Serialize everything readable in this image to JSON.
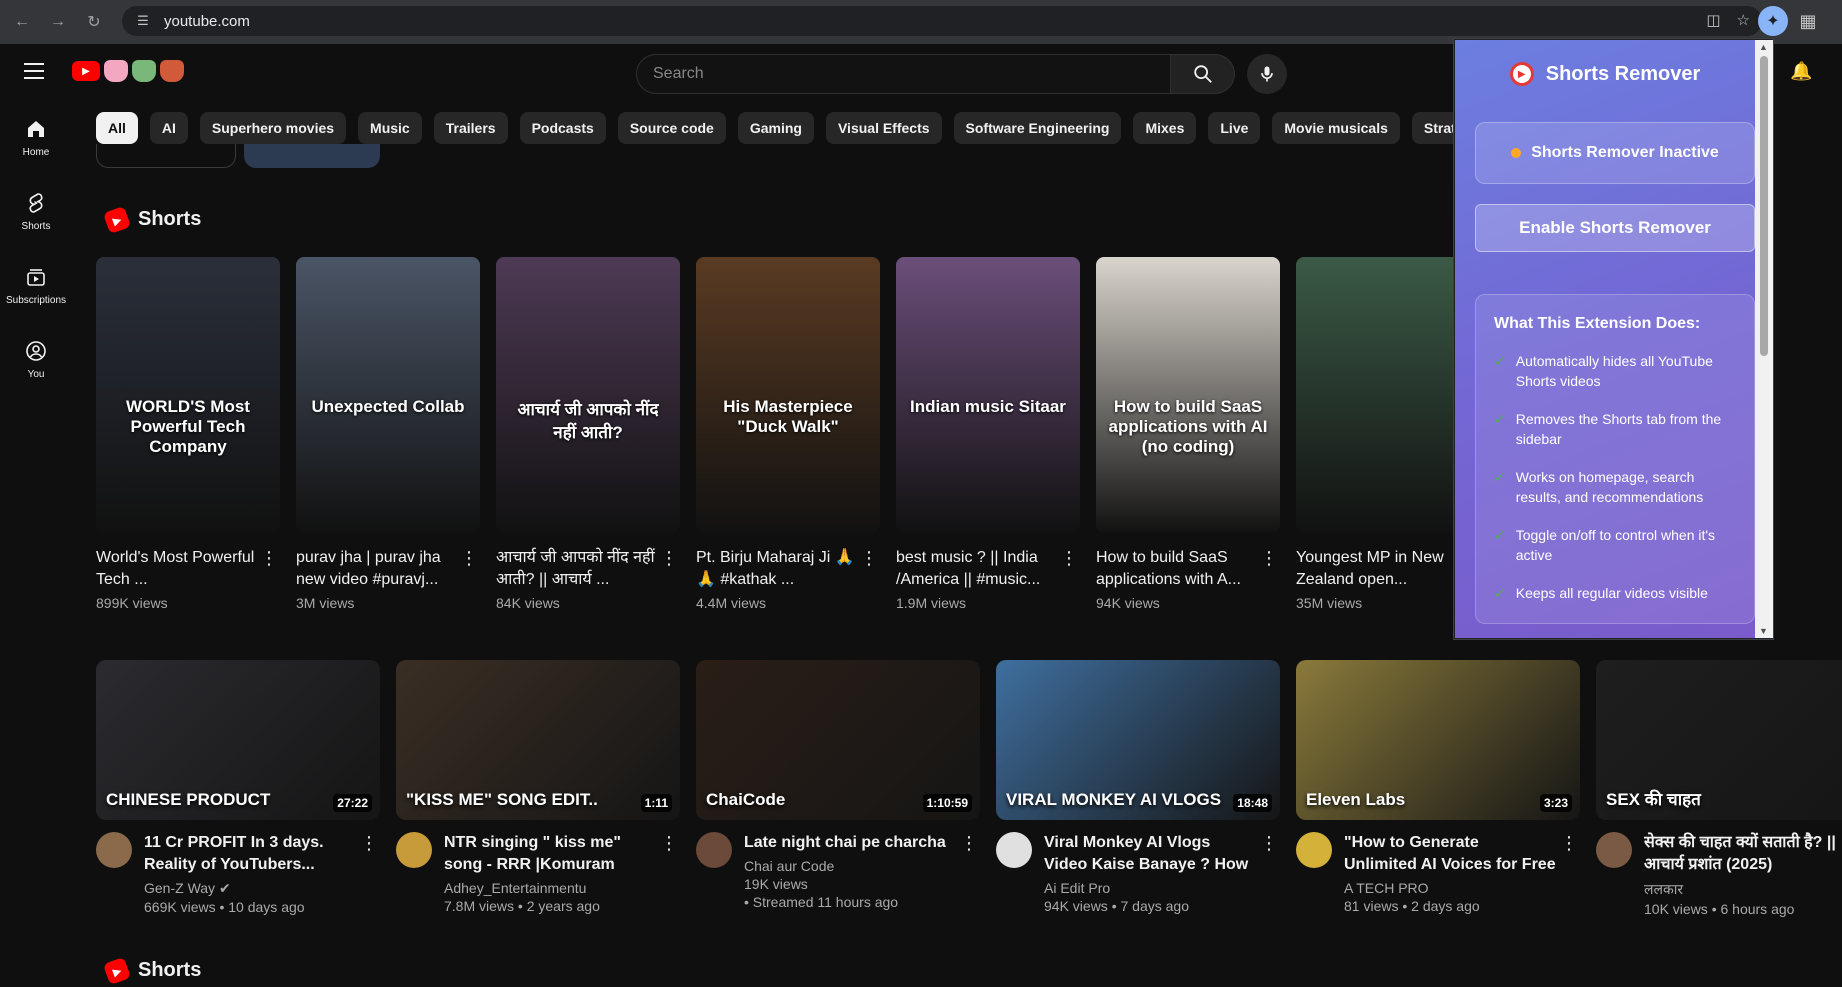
{
  "browser": {
    "url": "youtube.com"
  },
  "search": {
    "placeholder": "Search"
  },
  "guide": [
    {
      "label": "Home",
      "icon": "home-icon"
    },
    {
      "label": "Shorts",
      "icon": "shorts-icon"
    },
    {
      "label": "Subscriptions",
      "icon": "subscriptions-icon"
    },
    {
      "label": "You",
      "icon": "you-icon"
    }
  ],
  "chips": [
    "All",
    "AI",
    "Superhero movies",
    "Music",
    "Trailers",
    "Podcasts",
    "Source code",
    "Gaming",
    "Visual Effects",
    "Software Engineering",
    "Mixes",
    "Live",
    "Movie musicals",
    "Strategies"
  ],
  "shorts_section": {
    "title": "Shorts",
    "items": [
      {
        "title": "World's Most Powerful Tech ...",
        "views": "899K views",
        "thumb_text": "WORLD'S Most Powerful Tech Company",
        "bg": "#2a2f3a"
      },
      {
        "title": "purav jha | purav jha new video #puravj...",
        "views": "3M views",
        "thumb_text": "Unexpected Collab",
        "bg": "#4a5566"
      },
      {
        "title": "आचार्य जी आपको नींद नहीं आती? || आचार्य ...",
        "views": "84K views",
        "thumb_text": "आचार्य जी आपको नींद नहीं आती?",
        "bg": "#4e3a55"
      },
      {
        "title": "Pt. Birju Maharaj Ji 🙏🙏 #kathak ...",
        "views": "4.4M views",
        "thumb_text": "His Masterpiece \"Duck Walk\"",
        "bg": "#5a3b22"
      },
      {
        "title": "best music ? || India /America || #music...",
        "views": "1.9M views",
        "thumb_text": "Indian music Sitaar",
        "bg": "#6b4e7a"
      },
      {
        "title": "How to build SaaS applications with A...",
        "views": "94K views",
        "thumb_text": "How to build SaaS applications with AI (no coding)",
        "bg": "#d9d4cc"
      },
      {
        "title": "Youngest MP in New Zealand open...",
        "views": "35M views",
        "thumb_text": "",
        "bg": "#3b5a46"
      }
    ]
  },
  "videos": [
    {
      "title": "11 Cr PROFIT In 3 days. Reality of YouTubers...",
      "channel": "Gen-Z Way",
      "verified": true,
      "meta": "669K views • 10 days ago",
      "duration": "27:22",
      "thumb_text": "CHINESE PRODUCT",
      "bg": "#2b2b30",
      "avatar": "#8a6a4a"
    },
    {
      "title": "NTR singing \" kiss me\" song - RRR |Komuram Bheemudo...",
      "channel": "Adhey_Entertainmentu",
      "verified": false,
      "meta": "7.8M views • 2 years ago",
      "duration": "1:11",
      "thumb_text": "\"KISS ME\" SONG EDIT..",
      "bg": "#3a2e24",
      "avatar": "#c79a3a"
    },
    {
      "title": "Late night chai pe charcha",
      "channel": "Chai aur Code",
      "verified": false,
      "meta": "19K views",
      "meta2": "• Streamed 11 hours ago",
      "duration": "1:10:59",
      "thumb_text": "ChaiCode",
      "bg": "#2a1e16",
      "avatar": "#6b4a3a"
    },
    {
      "title": "Viral Monkey AI Vlogs Video Kaise Banaye ? How To Mak...",
      "channel": "Ai Edit Pro",
      "verified": false,
      "meta": "94K views • 7 days ago",
      "duration": "18:48",
      "thumb_text": "VIRAL MONKEY AI VLOGS",
      "bg": "#3f6f9f",
      "avatar": "#e0e0e0"
    },
    {
      "title": "\"How to Generate Unlimited AI Voices for Free | Step-by-...",
      "channel": "A TECH PRO",
      "verified": false,
      "meta": "81 views • 2 days ago",
      "duration": "3:23",
      "thumb_text": "Eleven Labs",
      "bg": "#8a7a3a",
      "avatar": "#d4b23a"
    },
    {
      "title": "सेक्स की चाहत क्यों सताती है? || आचार्य प्रशांत (2025)",
      "channel": "ललकार",
      "verified": false,
      "meta": "10K views • 6 hours ago",
      "duration": "",
      "thumb_text": "SEX की चाहत",
      "bg": "#1e1e1e",
      "avatar": "#7a5a44"
    }
  ],
  "shorts_section_2": {
    "title": "Shorts"
  },
  "extension": {
    "title": "Shorts Remover",
    "status": "Shorts Remover Inactive",
    "status_color": "#ffa726",
    "button": "Enable Shorts Remover",
    "info_title": "What This Extension Does:",
    "features": [
      "Automatically hides all YouTube Shorts videos",
      "Removes the Shorts tab from the sidebar",
      "Works on homepage, search results, and recommendations",
      "Toggle on/off to control when it's active",
      "Keeps all regular videos visible"
    ]
  },
  "colors": {
    "bg": "#0f0f0f",
    "accent_red": "#ff0000",
    "popup_gradient_start": "#6c7ee0",
    "popup_gradient_end": "#7a5bcb",
    "check_green": "#4caf50"
  }
}
